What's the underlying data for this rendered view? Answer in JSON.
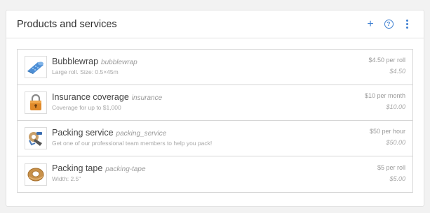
{
  "header": {
    "title": "Products and services",
    "add_icon": "plus-icon",
    "help_icon": "help-circle-icon",
    "menu_icon": "more-vertical-icon"
  },
  "accent_color": "#3d7fd1",
  "items": [
    {
      "name": "Bubblewrap",
      "slug": "bubblewrap",
      "description": "Large roll. Size: 0.5×45m",
      "price": "$4.50 per roll",
      "subprice": "$4.50",
      "icon": "bubblewrap-icon"
    },
    {
      "name": "Insurance coverage",
      "slug": "insurance",
      "description": "Coverage for up to $1,000",
      "price": "$10 per month",
      "subprice": "$10.00",
      "icon": "padlock-icon"
    },
    {
      "name": "Packing service",
      "slug": "packing_service",
      "description": "Get one of our professional team members to help you pack!",
      "price": "$50 per hour",
      "subprice": "$50.00",
      "icon": "tape-dispenser-icon"
    },
    {
      "name": "Packing tape",
      "slug": "packing-tape",
      "description": "Width: 2.5\"",
      "price": "$5 per roll",
      "subprice": "$5.00",
      "icon": "tape-roll-icon"
    }
  ]
}
